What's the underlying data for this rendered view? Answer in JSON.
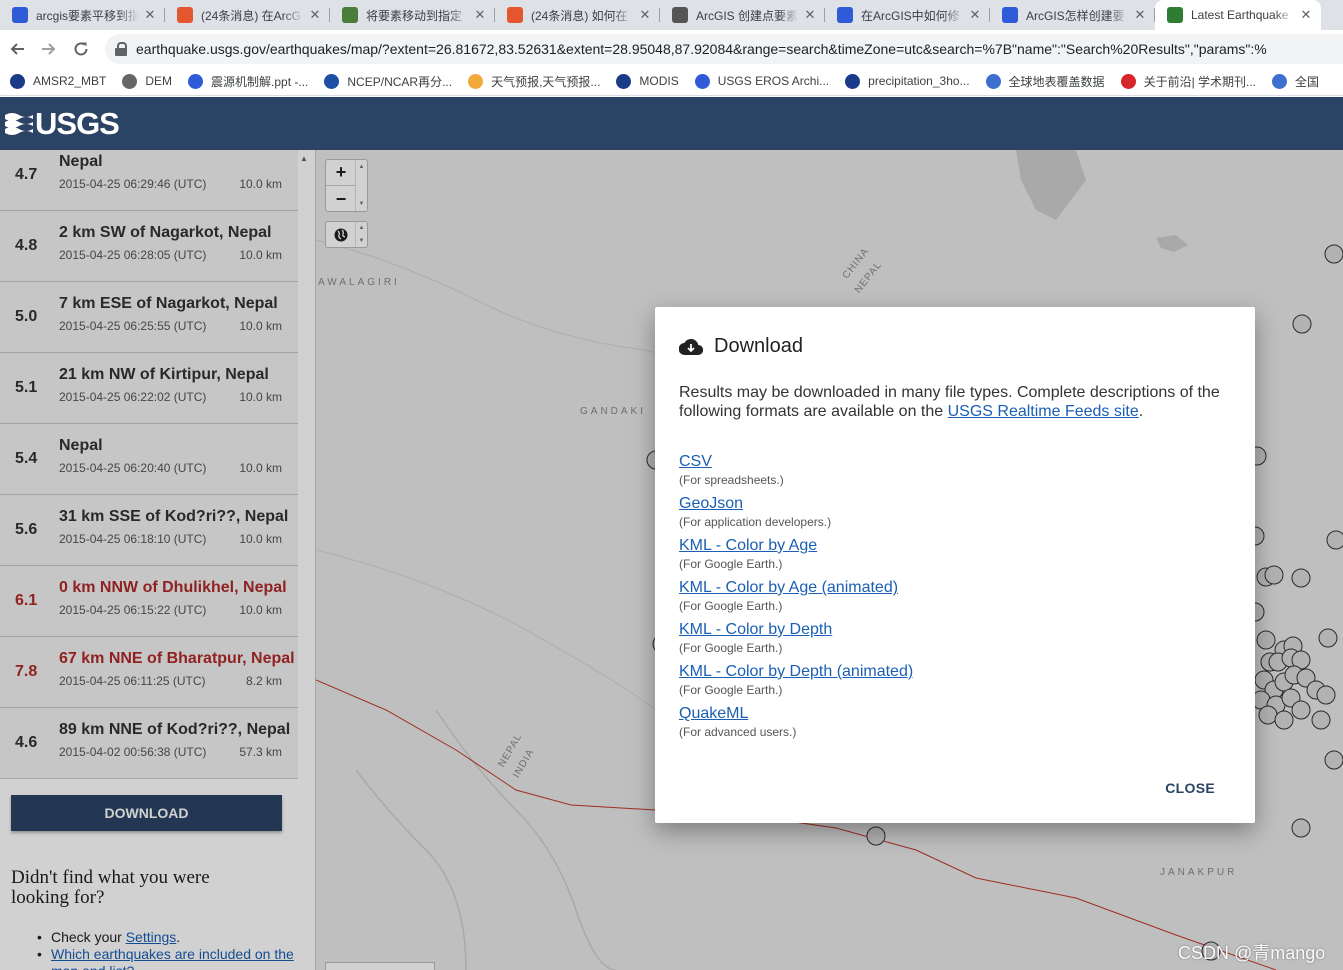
{
  "tabs": [
    {
      "title": "arcgis要素平移到指",
      "fav_color": "#2f5bd8",
      "fav_glyph": "paw-icon",
      "active": false
    },
    {
      "title": "(24条消息) 在ArcG",
      "fav_color": "#e4572e",
      "fav_glyph": "c-icon",
      "active": false
    },
    {
      "title": "将要素移动到指定",
      "fav_color": "#4a7d3a",
      "fav_glyph": "globe-icon",
      "active": false
    },
    {
      "title": "(24条消息) 如何在",
      "fav_color": "#e4572e",
      "fav_glyph": "c-icon",
      "active": false
    },
    {
      "title": "ArcGIS 创建点要素",
      "fav_color": "#555555",
      "fav_glyph": "globe-icon",
      "active": false
    },
    {
      "title": "在ArcGIS中如何修",
      "fav_color": "#2f5bd8",
      "fav_glyph": "paw-icon",
      "active": false
    },
    {
      "title": "ArcGIS怎样创建要",
      "fav_color": "#2f5bd8",
      "fav_glyph": "paw-icon",
      "active": false
    },
    {
      "title": "Latest Earthquake",
      "fav_color": "#2e7d32",
      "fav_glyph": "usgs-icon",
      "active": true
    }
  ],
  "address": {
    "url": "earthquake.usgs.gov/earthquakes/map/?extent=26.81672,83.52631&extent=28.95048,87.92084&range=search&timeZone=utc&search=%7B\"name\":\"Search%20Results\",\"params\":%"
  },
  "bookmarks": [
    {
      "label": "AMSR2_MBT",
      "color": "#1b3a8a"
    },
    {
      "label": "DEM",
      "color": "#666666"
    },
    {
      "label": "震源机制解.ppt -...",
      "color": "#2f5bd8"
    },
    {
      "label": "NCEP/NCAR再分...",
      "color": "#1d4fa3"
    },
    {
      "label": "天气预报,天气预报...",
      "color": "#f2a93b"
    },
    {
      "label": "MODIS",
      "color": "#1b3a8a"
    },
    {
      "label": "USGS EROS Archi...",
      "color": "#2f5bd8"
    },
    {
      "label": "precipitation_3ho...",
      "color": "#1b3a8a"
    },
    {
      "label": "全球地表覆盖数据",
      "color": "#3d6fd0"
    },
    {
      "label": "关于前沿| 学术期刊...",
      "color": "#d6252b"
    },
    {
      "label": "全国",
      "color": "#3d6fd0"
    }
  ],
  "header": {
    "logo_text": "USGS",
    "brand_color": "#2b4465"
  },
  "earthquakes": [
    {
      "mag": "4.7",
      "place": "Nepal",
      "time": "2015-04-25 06:29:46 (UTC)",
      "depth": "10.0 km",
      "significant": false
    },
    {
      "mag": "4.8",
      "place": "2 km SW of Nagarkot, Nepal",
      "time": "2015-04-25 06:28:05 (UTC)",
      "depth": "10.0 km",
      "significant": false
    },
    {
      "mag": "5.0",
      "place": "7 km ESE of Nagarkot, Nepal",
      "time": "2015-04-25 06:25:55 (UTC)",
      "depth": "10.0 km",
      "significant": false
    },
    {
      "mag": "5.1",
      "place": "21 km NW of Kirtipur, Nepal",
      "time": "2015-04-25 06:22:02 (UTC)",
      "depth": "10.0 km",
      "significant": false
    },
    {
      "mag": "5.4",
      "place": "Nepal",
      "time": "2015-04-25 06:20:40 (UTC)",
      "depth": "10.0 km",
      "significant": false
    },
    {
      "mag": "5.6",
      "place": "31 km SSE of Kod?ri??, Nepal",
      "time": "2015-04-25 06:18:10 (UTC)",
      "depth": "10.0 km",
      "significant": false
    },
    {
      "mag": "6.1",
      "place": "0 km NNW of Dhulikhel, Nepal",
      "time": "2015-04-25 06:15:22 (UTC)",
      "depth": "10.0 km",
      "significant": true
    },
    {
      "mag": "7.8",
      "place": "67 km NNE of Bharatpur, Nepal",
      "time": "2015-04-25 06:11:25 (UTC)",
      "depth": "8.2 km",
      "significant": true
    },
    {
      "mag": "4.6",
      "place": "89 km NNE of Kod?ri??, Nepal",
      "time": "2015-04-02 00:56:38 (UTC)",
      "depth": "57.3 km",
      "significant": false
    }
  ],
  "list_panel": {
    "download_label": "DOWNLOAD",
    "help_title": "Didn't find what you were looking for?",
    "help_items": [
      {
        "prefix": "Check your ",
        "link": "Settings",
        "suffix": "."
      },
      {
        "prefix": "",
        "link": "Which earthquakes are included on the map and list?",
        "suffix": ""
      }
    ]
  },
  "map": {
    "zoom_in": "+",
    "zoom_out": "−",
    "labels": [
      "AWALAGIRI",
      "GANDAKI",
      "CHINA",
      "NEPAL",
      "NEPAL",
      "INDIA",
      "JANAKPUR"
    ],
    "border_color": "#c0392b"
  },
  "modal": {
    "title": "Download",
    "desc_prefix": "Results may be downloaded in many file types. Complete descriptions of the following formats are available on the ",
    "desc_link": "USGS Realtime Feeds site",
    "desc_suffix": ".",
    "formats": [
      {
        "label": "CSV",
        "note": "(For spreadsheets.)"
      },
      {
        "label": "GeoJson",
        "note": "(For application developers.)"
      },
      {
        "label": "KML - Color by Age",
        "note": "(For Google Earth.)"
      },
      {
        "label": "KML - Color by Age (animated)",
        "note": "(For Google Earth.)"
      },
      {
        "label": "KML - Color by Depth",
        "note": "(For Google Earth.)"
      },
      {
        "label": "KML - Color by Depth (animated)",
        "note": "(For Google Earth.)"
      },
      {
        "label": "QuakeML",
        "note": "(For advanced users.)"
      }
    ],
    "close_label": "CLOSE"
  },
  "watermark": "CSDN @青mango"
}
